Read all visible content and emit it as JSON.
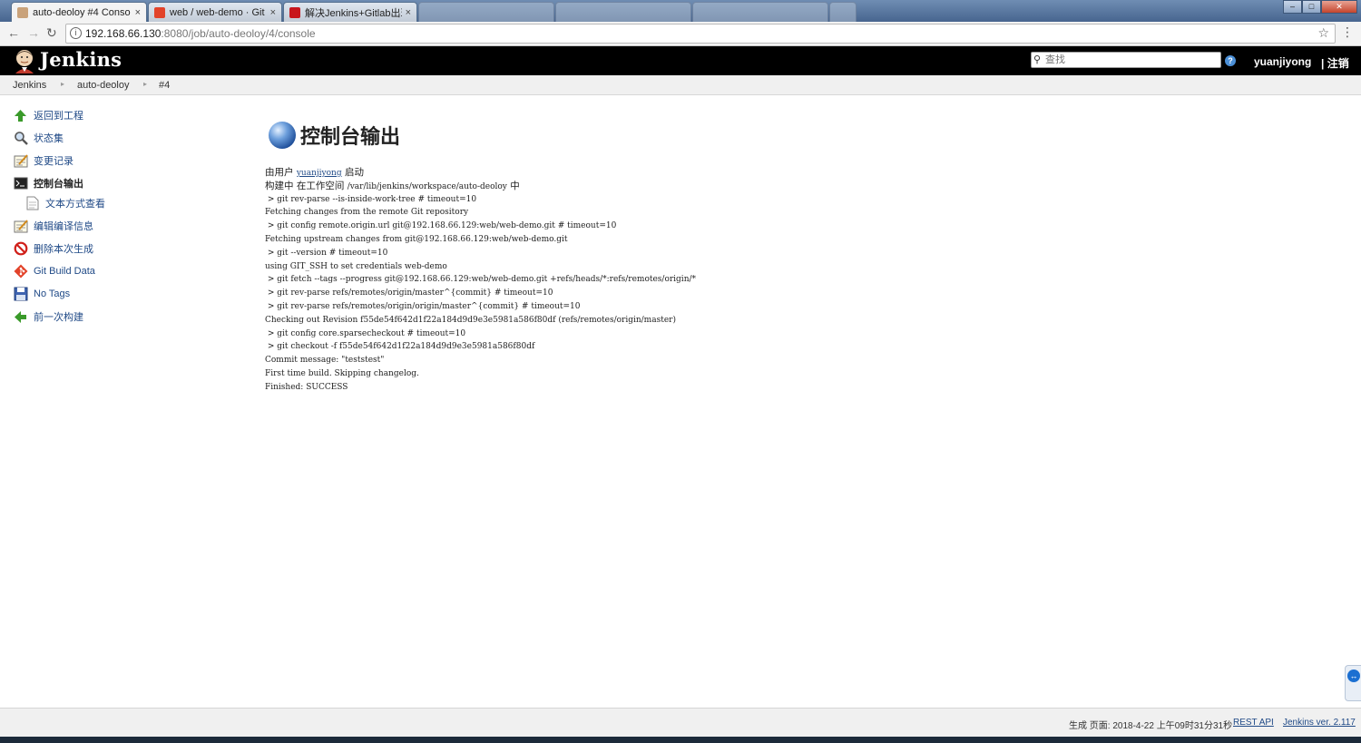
{
  "browser": {
    "tabs": [
      {
        "title": "auto-deoloy #4 Conso",
        "active": true
      },
      {
        "title": "web / web-demo · Git",
        "active": false
      },
      {
        "title": "解决Jenkins+Gitlab出现",
        "active": false
      }
    ],
    "url_host": "192.168.66.130",
    "url_path": ":8080/job/auto-deoloy/4/console",
    "close_glyph": "×"
  },
  "header": {
    "brand": "Jenkins",
    "search_placeholder": "查找",
    "help_glyph": "?",
    "user": "yuanjiyong",
    "logout": "| 注销"
  },
  "breadcrumb": [
    "Jenkins",
    "auto-deoloy",
    "#4"
  ],
  "sidebar": {
    "items": [
      {
        "label": "返回到工程",
        "icon": "up-arrow-icon"
      },
      {
        "label": "状态集",
        "icon": "magnifier-icon"
      },
      {
        "label": "变更记录",
        "icon": "notepad-icon"
      },
      {
        "label": "控制台输出",
        "icon": "terminal-icon"
      },
      {
        "label": "文本方式查看",
        "icon": "document-icon"
      },
      {
        "label": "编辑编译信息",
        "icon": "notepad-icon"
      },
      {
        "label": "删除本次生成",
        "icon": "no-entry-icon"
      },
      {
        "label": "Git Build Data",
        "icon": "git-icon"
      },
      {
        "label": "No Tags",
        "icon": "save-icon"
      },
      {
        "label": "前一次构建",
        "icon": "left-arrow-icon"
      }
    ]
  },
  "main": {
    "title": "控制台输出",
    "started_by_prefix": "由用户 ",
    "started_by_user": "yuanjiyong",
    "started_by_suffix": " 启动",
    "building_prefix": "构建中 在工作空间 ",
    "building_path": "/var/lib/jenkins/workspace/auto-deoloy",
    "building_suffix": " 中",
    "lines": [
      " > git rev-parse --is-inside-work-tree # timeout=10",
      "Fetching changes from the remote Git repository",
      " > git config remote.origin.url git@192.168.66.129:web/web-demo.git # timeout=10",
      "Fetching upstream changes from git@192.168.66.129:web/web-demo.git",
      " > git --version # timeout=10",
      "using GIT_SSH to set credentials web-demo",
      " > git fetch --tags --progress git@192.168.66.129:web/web-demo.git +refs/heads/*:refs/remotes/origin/*",
      " > git rev-parse refs/remotes/origin/master^{commit} # timeout=10",
      " > git rev-parse refs/remotes/origin/origin/master^{commit} # timeout=10",
      "Checking out Revision f55de54f642d1f22a184d9d9e3e5981a586f80df (refs/remotes/origin/master)",
      " > git config core.sparsecheckout # timeout=10",
      " > git checkout -f f55de54f642d1f22a184d9d9e3e5981a586f80df",
      "Commit message: \"teststest\"",
      "First time build. Skipping changelog.",
      "Finished: SUCCESS"
    ]
  },
  "footer": {
    "generated": "生成 页面: 2018-4-22 上午09时31分31秒",
    "rest_api": "REST API",
    "version": "Jenkins ver. 2.117"
  },
  "colors": {
    "link": "#204a87",
    "header_bg": "#000000",
    "accent": "#d24939"
  }
}
